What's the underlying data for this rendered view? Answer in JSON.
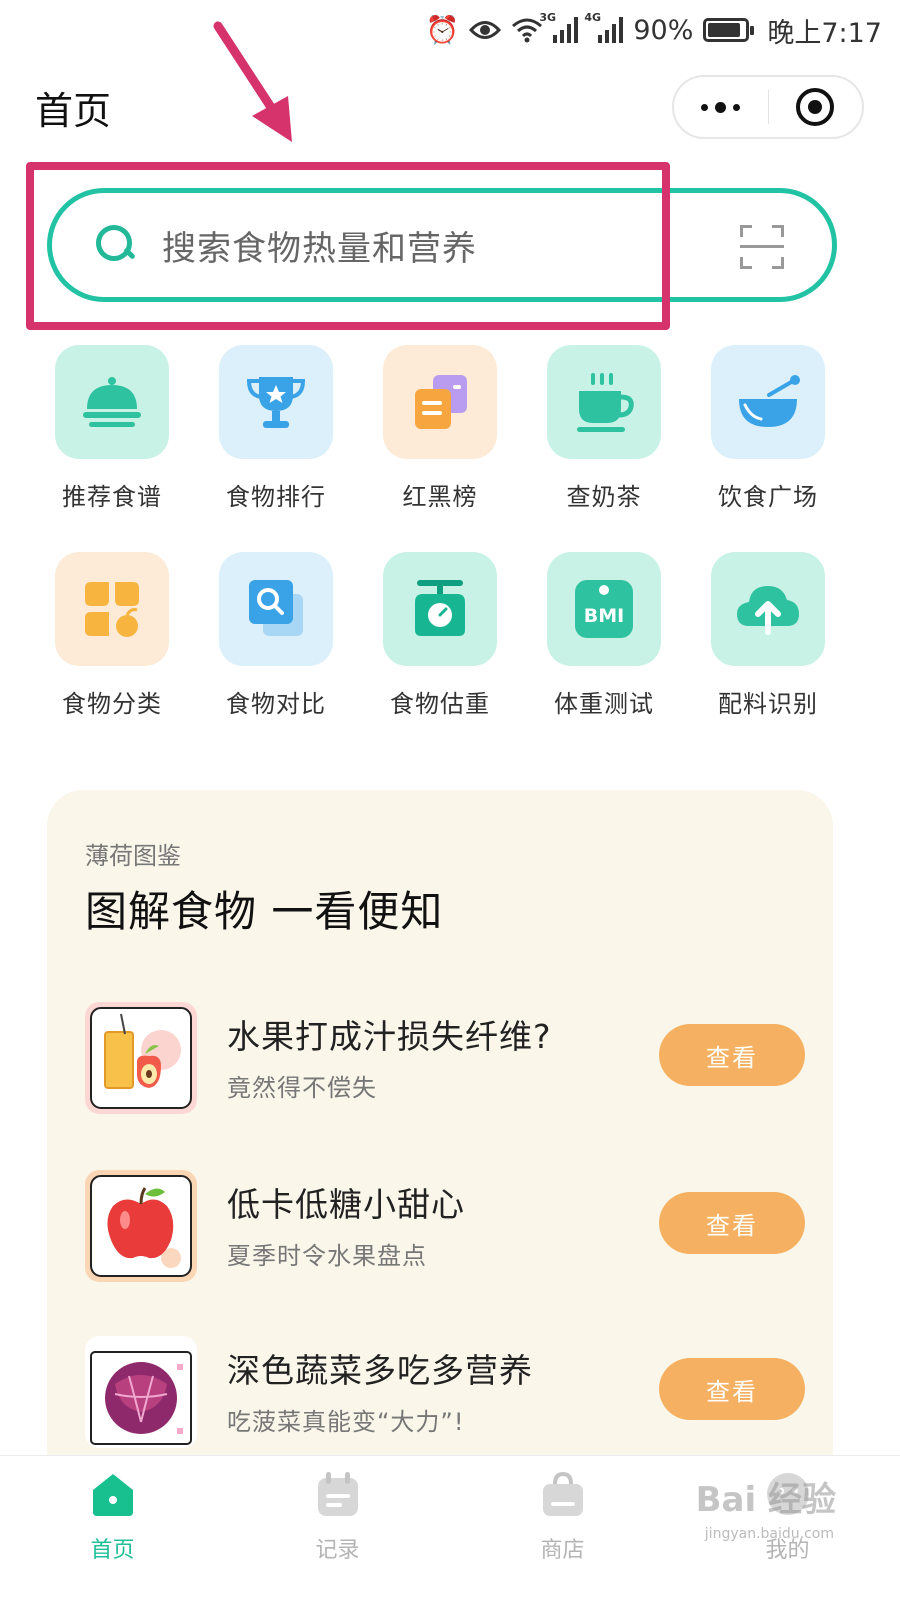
{
  "status_bar": {
    "signal_1": "3G",
    "signal_2": "4G",
    "battery": "90%",
    "time": "晚上7:17"
  },
  "header": {
    "title": "首页"
  },
  "search": {
    "placeholder": "搜索食物热量和营养"
  },
  "grid": [
    {
      "label": "推荐食谱",
      "icon": "cloche-icon"
    },
    {
      "label": "食物排行",
      "icon": "trophy-icon"
    },
    {
      "label": "红黑榜",
      "icon": "cards-icon"
    },
    {
      "label": "查奶茶",
      "icon": "cup-icon"
    },
    {
      "label": "饮食广场",
      "icon": "bowl-icon"
    },
    {
      "label": "食物分类",
      "icon": "category-icon"
    },
    {
      "label": "食物对比",
      "icon": "compare-icon"
    },
    {
      "label": "食物估重",
      "icon": "scale-icon"
    },
    {
      "label": "体重测试",
      "icon": "bmi-icon"
    },
    {
      "label": "配料识别",
      "icon": "upload-cloud-icon"
    }
  ],
  "grid_bmi_text": "BMI",
  "card": {
    "subtitle": "薄荷图鉴",
    "title": "图解食物 一看便知",
    "articles": [
      {
        "title": "水果打成汁损失纤维?",
        "desc": "竟然得不偿失",
        "button": "查看"
      },
      {
        "title": "低卡低糖小甜心",
        "desc": "夏季时令水果盘点",
        "button": "查看"
      },
      {
        "title": "深色蔬菜多吃多营养",
        "desc": "吃菠菜真能变“大力”!",
        "button": "查看"
      }
    ]
  },
  "tabs": [
    {
      "label": "首页",
      "active": true
    },
    {
      "label": "记录",
      "active": false
    },
    {
      "label": "商店",
      "active": false
    },
    {
      "label": "我的",
      "active": false
    }
  ],
  "watermark": {
    "main": "Bai 经验",
    "sub": "jingyan.baidu.com"
  },
  "colors": {
    "accent": "#22c3a4",
    "annotation": "#d6336c",
    "button": "#f5b161",
    "card_bg": "#faf6ea"
  },
  "battery_level": 0.9
}
